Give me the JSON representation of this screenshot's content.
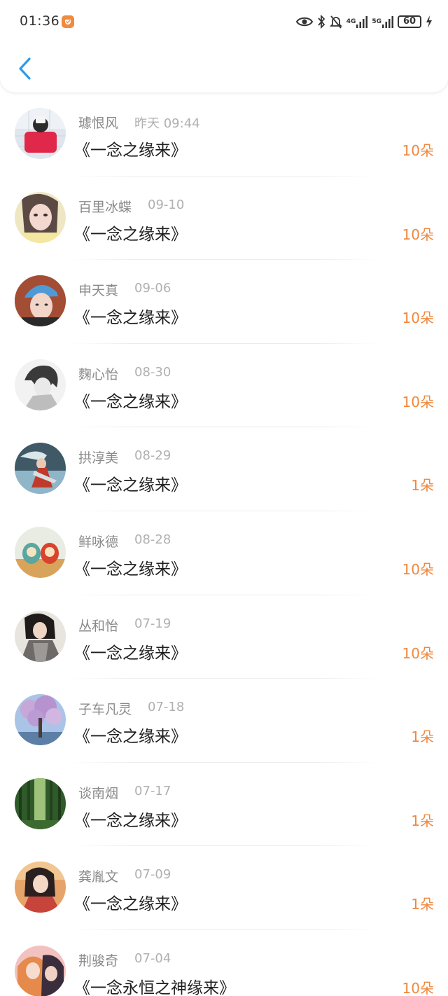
{
  "status_bar": {
    "time": "01:36",
    "network_1": "4G",
    "network_2": "5G",
    "battery": "60",
    "icons": [
      "eye-icon",
      "bluetooth-icon",
      "mute-bell-icon",
      "signal-icon",
      "signal-icon",
      "battery-icon",
      "charging-icon"
    ]
  },
  "header": {
    "back_icon": "chevron-left-icon",
    "accent": "#2f9ae6"
  },
  "colors": {
    "count": "#f0883e",
    "name": "#8a8a8a",
    "date": "#b0b0b0",
    "title": "#1e1e1e"
  },
  "records": [
    {
      "name": "璩恨风",
      "date": "昨天 09:44",
      "title": "《一念之缘来》",
      "count": "10朵",
      "avatar": "avatar-red-shirt"
    },
    {
      "name": "百里冰蝶",
      "date": "09-10",
      "title": "《一念之缘来》",
      "count": "10朵",
      "avatar": "avatar-girl-portrait"
    },
    {
      "name": "申天真",
      "date": "09-06",
      "title": "《一念之缘来》",
      "count": "10朵",
      "avatar": "avatar-blue-cap"
    },
    {
      "name": "麴心怡",
      "date": "08-30",
      "title": "《一念之缘来》",
      "count": "10朵",
      "avatar": "avatar-anime-sketch"
    },
    {
      "name": "拱淳美",
      "date": "08-29",
      "title": "《一念之缘来》",
      "count": "1朵",
      "avatar": "avatar-warrior"
    },
    {
      "name": "鲜咏德",
      "date": "08-28",
      "title": "《一念之缘来》",
      "count": "10朵",
      "avatar": "avatar-dolls"
    },
    {
      "name": "丛和怡",
      "date": "07-19",
      "title": "《一念之缘来》",
      "count": "10朵",
      "avatar": "avatar-dark-portrait"
    },
    {
      "name": "子车凡灵",
      "date": "07-18",
      "title": "《一念之缘来》",
      "count": "1朵",
      "avatar": "avatar-blossom-tree"
    },
    {
      "name": "谈南烟",
      "date": "07-17",
      "title": "《一念之缘来》",
      "count": "1朵",
      "avatar": "avatar-forest"
    },
    {
      "name": "龚胤文",
      "date": "07-09",
      "title": "《一念之缘来》",
      "count": "1朵",
      "avatar": "avatar-anime-sunset"
    },
    {
      "name": "荆骏奇",
      "date": "07-04",
      "title": "《一念永恒之神缘来》",
      "count": "10朵",
      "avatar": "avatar-anime-hug"
    }
  ]
}
